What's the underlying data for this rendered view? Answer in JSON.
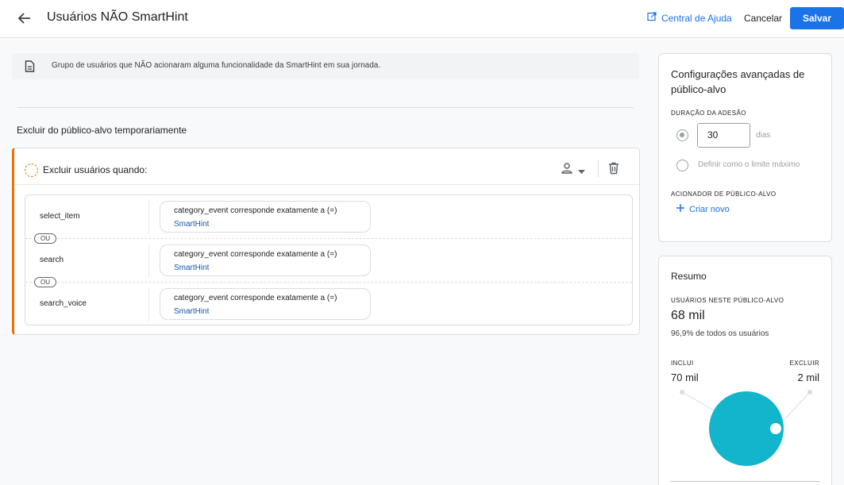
{
  "header": {
    "title": "Usuários NÃO SmartHint",
    "help_label": "Central de Ajuda",
    "cancel_label": "Cancelar",
    "save_label": "Salvar"
  },
  "description": "Grupo de usuários que NÃO acionaram alguma funcionalidade da SmartHint em sua jornada.",
  "exclude_section": {
    "title": "Excluir do público-alvo temporariamente",
    "card_label": "Excluir usuários quando:",
    "or_label": "OU",
    "conditions": [
      {
        "event": "select_item",
        "param_label": "category_event corresponde exatamente a (=)",
        "param_value": "SmartHint"
      },
      {
        "event": "search",
        "param_label": "category_event corresponde exatamente a (=)",
        "param_value": "SmartHint"
      },
      {
        "event": "search_voice",
        "param_label": "category_event corresponde exatamente a (=)",
        "param_value": "SmartHint"
      }
    ]
  },
  "advanced": {
    "title": "Configurações avançadas de público-alvo",
    "duration_label": "DURAÇÃO DA ADESÃO",
    "duration_value": "30",
    "duration_unit": "dias",
    "max_label": "Definir como o limite máximo",
    "trigger_label": "ACIONADOR DE PÚBLICO-ALVO",
    "create_label": "Criar novo"
  },
  "summary": {
    "title": "Resumo",
    "users_label": "USUÁRIOS NESTE PÚBLICO-ALVO",
    "users_count": "68 mil",
    "users_pct": "96,9% de todos os usuários",
    "include_label": "INCLUI",
    "include_value": "70 mil",
    "exclude_label": "EXCLUIR",
    "exclude_value": "2 mil",
    "include_color": "#12b5cb",
    "exclude_color": "#ffffff"
  }
}
